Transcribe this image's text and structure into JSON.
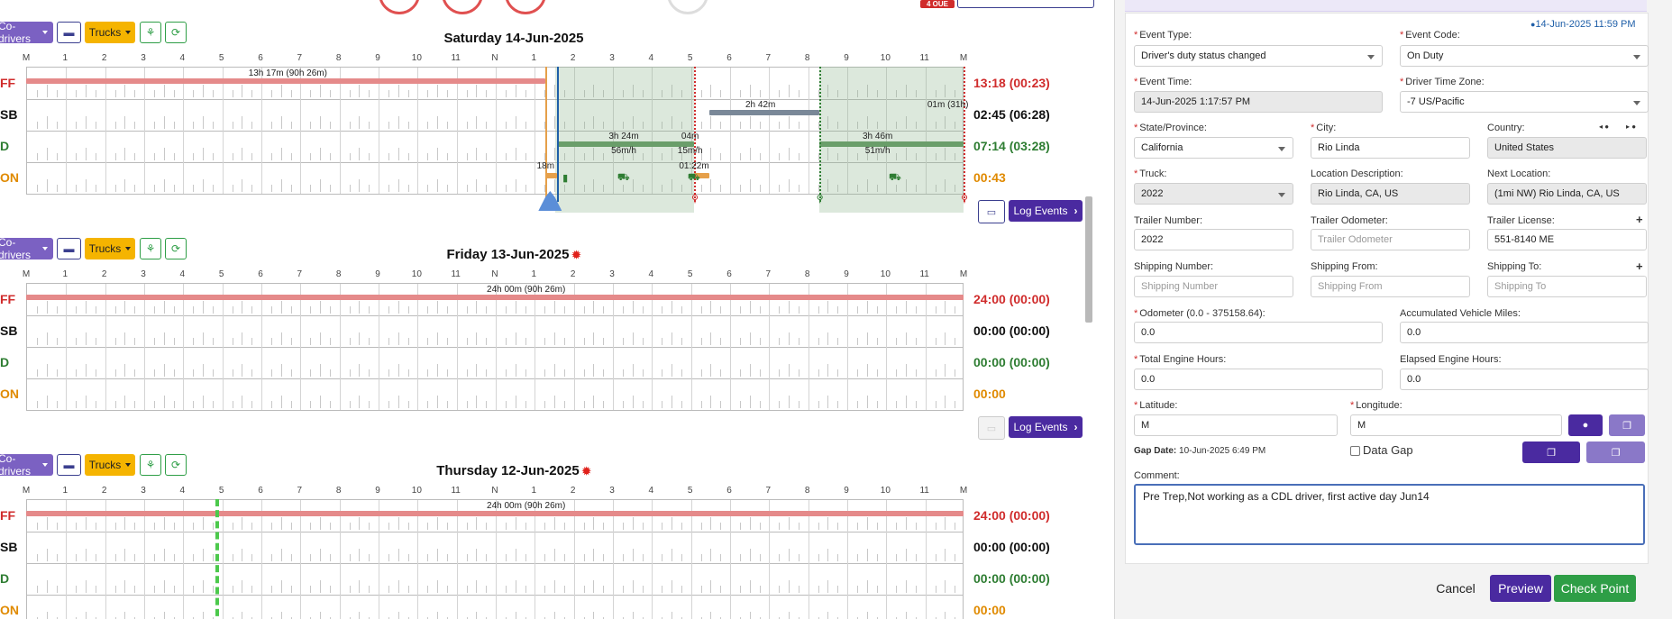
{
  "toolbar": {
    "codrivers": "Co-drivers",
    "trucks": "Trucks"
  },
  "hour_labels": [
    "M",
    "1",
    "2",
    "3",
    "4",
    "5",
    "6",
    "7",
    "8",
    "9",
    "10",
    "11",
    "N",
    "1",
    "2",
    "3",
    "4",
    "5",
    "6",
    "7",
    "8",
    "9",
    "10",
    "11",
    "M"
  ],
  "status_labels": [
    "FF",
    "SB",
    "D",
    "ON"
  ],
  "days": [
    {
      "title": "Saturday 14-Jun-2025",
      "has_alert": false,
      "totals": [
        "13:18 (00:23)",
        "02:45 (06:28)",
        "07:14 (03:28)",
        "00:43"
      ],
      "segment_labels": {
        "off": "13h 17m (90h 26m)",
        "sb": "2h 42m",
        "sb_end": "01m (31h)",
        "d1": "3h 24m",
        "d1_speed": "56m/h",
        "d_short": "04m",
        "d_short_speed": "15m/h",
        "d2": "3h 46m",
        "d2_speed": "51m/h",
        "on1": "18m",
        "on2": "01:22m"
      },
      "log_events": "Log Events"
    },
    {
      "title": "Friday 13-Jun-2025",
      "has_alert": true,
      "totals": [
        "24:00 (00:00)",
        "00:00 (00:00)",
        "00:00 (00:00)",
        "00:00"
      ],
      "segment_labels": {
        "off": "24h 00m (90h 26m)"
      },
      "log_events": "Log Events"
    },
    {
      "title": "Thursday 12-Jun-2025",
      "has_alert": true,
      "totals": [
        "24:00 (00:00)",
        "00:00 (00:00)",
        "00:00 (00:00)",
        "00:00"
      ],
      "segment_labels": {
        "off": "24h 00m (90h 26m)"
      },
      "log_events": ""
    }
  ],
  "header_badge": "4 OUE",
  "panel": {
    "timestamp": "14-Jun-2025 11:59 PM",
    "event_type": {
      "label": "Event Type:",
      "value": "Driver's duty status changed"
    },
    "event_code": {
      "label": "Event Code:",
      "value": "On Duty"
    },
    "event_time": {
      "label": "Event Time:",
      "value": "14-Jun-2025 1:17:57 PM"
    },
    "driver_tz": {
      "label": "Driver Time Zone:",
      "value": "-7 US/Pacific"
    },
    "state": {
      "label": "State/Province:",
      "value": "California"
    },
    "city": {
      "label": "City:",
      "value": "Rio Linda"
    },
    "country": {
      "label": "Country:",
      "value": "United States"
    },
    "truck": {
      "label": "Truck:",
      "value": "2022"
    },
    "location_desc": {
      "label": "Location Description:",
      "value": "Rio Linda, CA, US"
    },
    "next_location": {
      "label": "Next Location:",
      "value": "(1mi NW) Rio Linda, CA, US"
    },
    "trailer_number": {
      "label": "Trailer Number:",
      "value": "2022"
    },
    "trailer_odometer": {
      "label": "Trailer Odometer:",
      "placeholder": "Trailer Odometer"
    },
    "trailer_license": {
      "label": "Trailer License:",
      "value": "551-8140   ME"
    },
    "shipping_number": {
      "label": "Shipping Number:",
      "placeholder": "Shipping Number"
    },
    "shipping_from": {
      "label": "Shipping From:",
      "placeholder": "Shipping From"
    },
    "shipping_to": {
      "label": "Shipping To:",
      "placeholder": "Shipping To"
    },
    "odometer": {
      "label": "Odometer (0.0 - 375158.64):",
      "value": "0.0"
    },
    "accum_miles": {
      "label": "Accumulated Vehicle Miles:",
      "value": "0.0"
    },
    "engine_hours": {
      "label": "Total Engine Hours:",
      "value": "0.0"
    },
    "elapsed_hours": {
      "label": "Elapsed Engine Hours:",
      "value": "0.0"
    },
    "latitude": {
      "label": "Latitude:",
      "value": "M"
    },
    "longitude": {
      "label": "Longitude:",
      "value": "M"
    },
    "gap_date_label": "Gap Date:",
    "gap_date_value": "10-Jun-2025 6:49 PM",
    "data_gap": "Data Gap",
    "comment": {
      "label": "Comment:",
      "value": "Pre Trep,Not working as a CDL driver, first active day Jun14"
    },
    "cancel": "Cancel",
    "preview": "Preview",
    "checkpoint": "Check Point"
  },
  "colors": {
    "accent": "#4a2aa0",
    "off": "#d02c2c",
    "drive": "#2e7d32",
    "on": "#e08a00",
    "success": "#2e9e46"
  }
}
